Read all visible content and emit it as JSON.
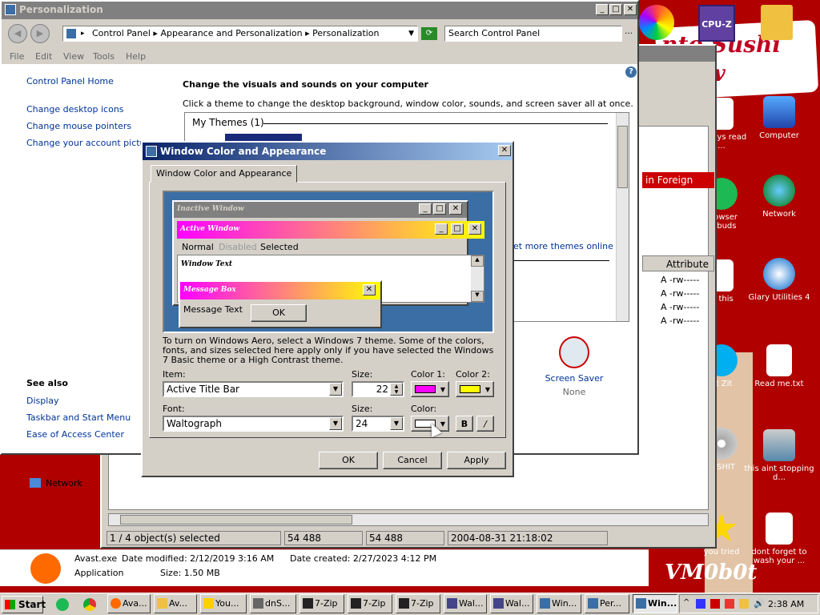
{
  "desktop": {
    "banner": "nto Sushi chew",
    "watermark": "VM0b0t",
    "icons": [
      {
        "label": "Computer"
      },
      {
        "label": "Network"
      },
      {
        "label": "Glary Utilities 4"
      },
      {
        "label": "Read me.txt"
      },
      {
        "label": "this aint stopping d..."
      },
      {
        "label": "dont forget to wash your ..."
      },
      {
        "label": "are Sys read ..."
      },
      {
        "label": "browser udbuds"
      },
      {
        "label": "is this"
      },
      {
        "label": "at Zit"
      },
      {
        "label": "LLSHIT"
      },
      {
        "label": "you tried"
      }
    ]
  },
  "personalization": {
    "title": "Personalization",
    "address": [
      "Control Panel",
      "Appearance and Personalization",
      "Personalization"
    ],
    "search_placeholder": "Search Control Panel",
    "menu": [
      "File",
      "Edit",
      "View",
      "Tools",
      "Help"
    ],
    "sidebar": {
      "home": "Control Panel Home",
      "links": [
        "Change desktop icons",
        "Change mouse pointers",
        "Change your account picture"
      ],
      "see_also": "See also",
      "see_also_links": [
        "Display",
        "Taskbar and Start Menu",
        "Ease of Access Center"
      ]
    },
    "heading": "Change the visuals and sounds on your computer",
    "subheading": "Click a theme to change the desktop background, window color, sounds, and screen saver all at once.",
    "my_themes": "My Themes (1)",
    "more_themes": "et more themes online",
    "screen_saver": {
      "label": "Screen Saver",
      "value": "None"
    }
  },
  "bg_window": {
    "foreign": "in Foreign look",
    "attribute": "Attribute",
    "attrs": [
      "A -rw-----",
      "A -rw-----",
      "A -rw-----",
      "A -rw-----"
    ],
    "status": [
      "1 / 4 object(s) selected",
      "54 488",
      "54 488",
      "2004-08-31 21:18:02"
    ],
    "network": "Network"
  },
  "avast": {
    "name": "Avast.exe",
    "modified": "Date modified: 2/12/2019 3:16 AM",
    "created": "Date created: 2/27/2023 4:12 PM",
    "type": "Application",
    "size": "Size: 1.50 MB"
  },
  "dialog": {
    "title": "Window Color and Appearance",
    "tab": "Window Color and Appearance",
    "preview": {
      "inactive": "Inactive Window",
      "active": "Active Window",
      "menu": [
        "Normal",
        "Disabled",
        "Selected"
      ],
      "window_text": "Window Text",
      "message_box": "Message Box",
      "message_text": "Message Text",
      "ok": "OK"
    },
    "info": "To turn on Windows Aero, select a Windows 7 theme.  Some of the colors, fonts, and sizes selected here apply only if you have selected the Windows 7 Basic theme or a High Contrast theme.",
    "item_label": "Item:",
    "item_value": "Active Title Bar",
    "size_label": "Size:",
    "size_value": "22",
    "color1_label": "Color 1:",
    "color2_label": "Color 2:",
    "color1": "#ff00ff",
    "color2": "#ffff00",
    "font_label": "Font:",
    "font_value": "Waltograph",
    "font_size_label": "Size:",
    "font_size_value": "24",
    "font_color_label": "Color:",
    "font_color": "#ffffff",
    "bold": "B",
    "italic": "/",
    "ok": "OK",
    "cancel": "Cancel",
    "apply": "Apply"
  },
  "taskbar": {
    "start": "Start",
    "items": [
      "Ava...",
      "Av...",
      "You...",
      "dnS...",
      "7-Zip",
      "7-Zip",
      "7-Zip",
      "Wal...",
      "Wal...",
      "Win...",
      "Per...",
      "Win..."
    ],
    "clock": "2:38 AM"
  }
}
